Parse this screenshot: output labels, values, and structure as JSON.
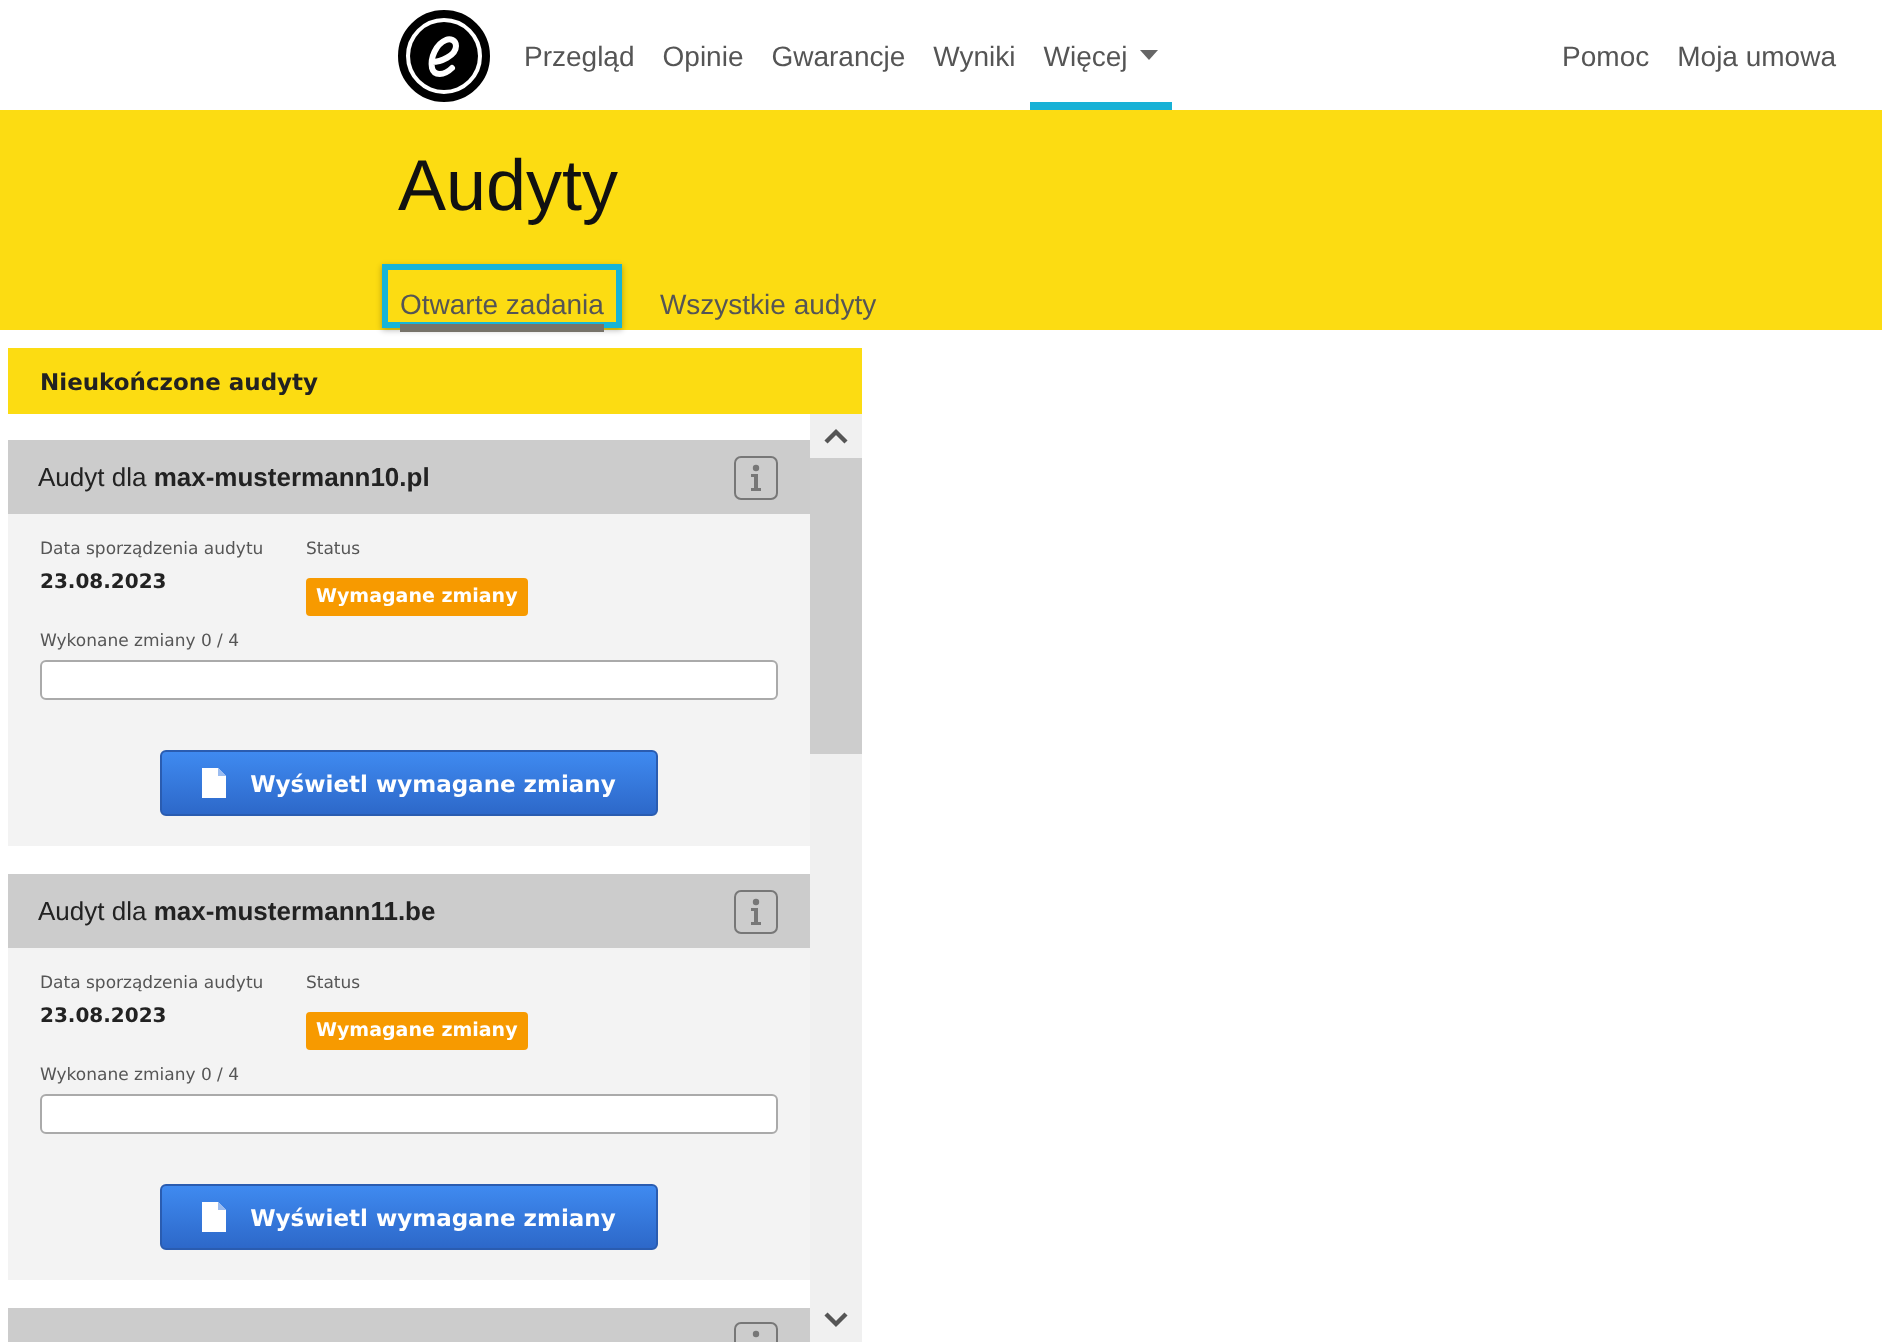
{
  "nav": {
    "items": [
      {
        "label": "Przegląd",
        "selected": false,
        "dropdown": false
      },
      {
        "label": "Opinie",
        "selected": false,
        "dropdown": false
      },
      {
        "label": "Gwarancje",
        "selected": false,
        "dropdown": false
      },
      {
        "label": "Wyniki",
        "selected": false,
        "dropdown": false
      },
      {
        "label": "Więcej",
        "selected": true,
        "dropdown": true
      }
    ],
    "right_items": [
      "Pomoc",
      "Moja umowa"
    ]
  },
  "page_title": "Audyty",
  "tabs": [
    {
      "label": "Otwarte zadania",
      "selected": true,
      "highlighted": true
    },
    {
      "label": "Wszystkie audyty",
      "selected": false,
      "highlighted": false
    }
  ],
  "panel": {
    "title": "Nieukończone audyty",
    "audits": [
      {
        "title_prefix": "Audyt dla",
        "domain": "max-mustermann10.pl",
        "date_label": "Data sporządzenia audytu",
        "date": "23.08.2023",
        "status_label": "Status",
        "status": "Wymagane zmiany",
        "progress_label": "Wykonane zmiany 0 / 4",
        "level": 0,
        "button": "Wyświetl wymagane zmiany"
      },
      {
        "title_prefix": "Audyt dla",
        "domain": "max-mustermann11.be",
        "date_label": "Data sporządzenia audytu",
        "date": "23.08.2023",
        "status_label": "Status",
        "status": "Wymagane zmiany",
        "progress_label": "Wykonane zmiany 0 / 4",
        "level": 0,
        "button": "Wyświetl wymagane zmiany"
      }
    ]
  }
}
